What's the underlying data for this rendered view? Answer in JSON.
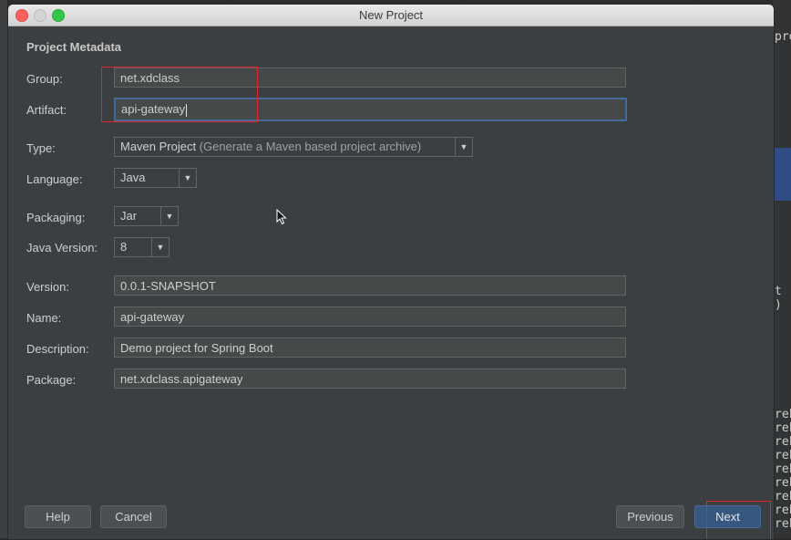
{
  "window": {
    "title": "New Project"
  },
  "section_title": "Project Metadata",
  "fields": {
    "group": {
      "label": "Group:",
      "value": "net.xdclass"
    },
    "artifact": {
      "label": "Artifact:",
      "value": "api-gateway"
    },
    "type": {
      "label": "Type:",
      "value": "Maven Project",
      "hint": "(Generate a Maven based project archive)"
    },
    "language": {
      "label": "Language:",
      "value": "Java"
    },
    "packaging": {
      "label": "Packaging:",
      "value": "Jar"
    },
    "java_version": {
      "label": "Java Version:",
      "value": "8"
    },
    "version": {
      "label": "Version:",
      "value": "0.0.1-SNAPSHOT"
    },
    "name": {
      "label": "Name:",
      "value": "api-gateway"
    },
    "description": {
      "label": "Description:",
      "value": "Demo project for Spring Boot"
    },
    "package": {
      "label": "Package:",
      "value": "net.xdclass.apigateway"
    }
  },
  "buttons": {
    "help": "Help",
    "cancel": "Cancel",
    "previous": "Previous",
    "next": "Next"
  },
  "background": {
    "right_text_top": "pro",
    "right_text_mid": "t )",
    "right_lines": [
      "rek",
      "rek",
      "rek",
      "rek",
      "rek",
      "rek",
      "rek",
      "rek",
      "rek"
    ]
  },
  "colors": {
    "accent_focus": "#46699d",
    "highlight_box": "#e02525",
    "primary_button": "#365880"
  }
}
